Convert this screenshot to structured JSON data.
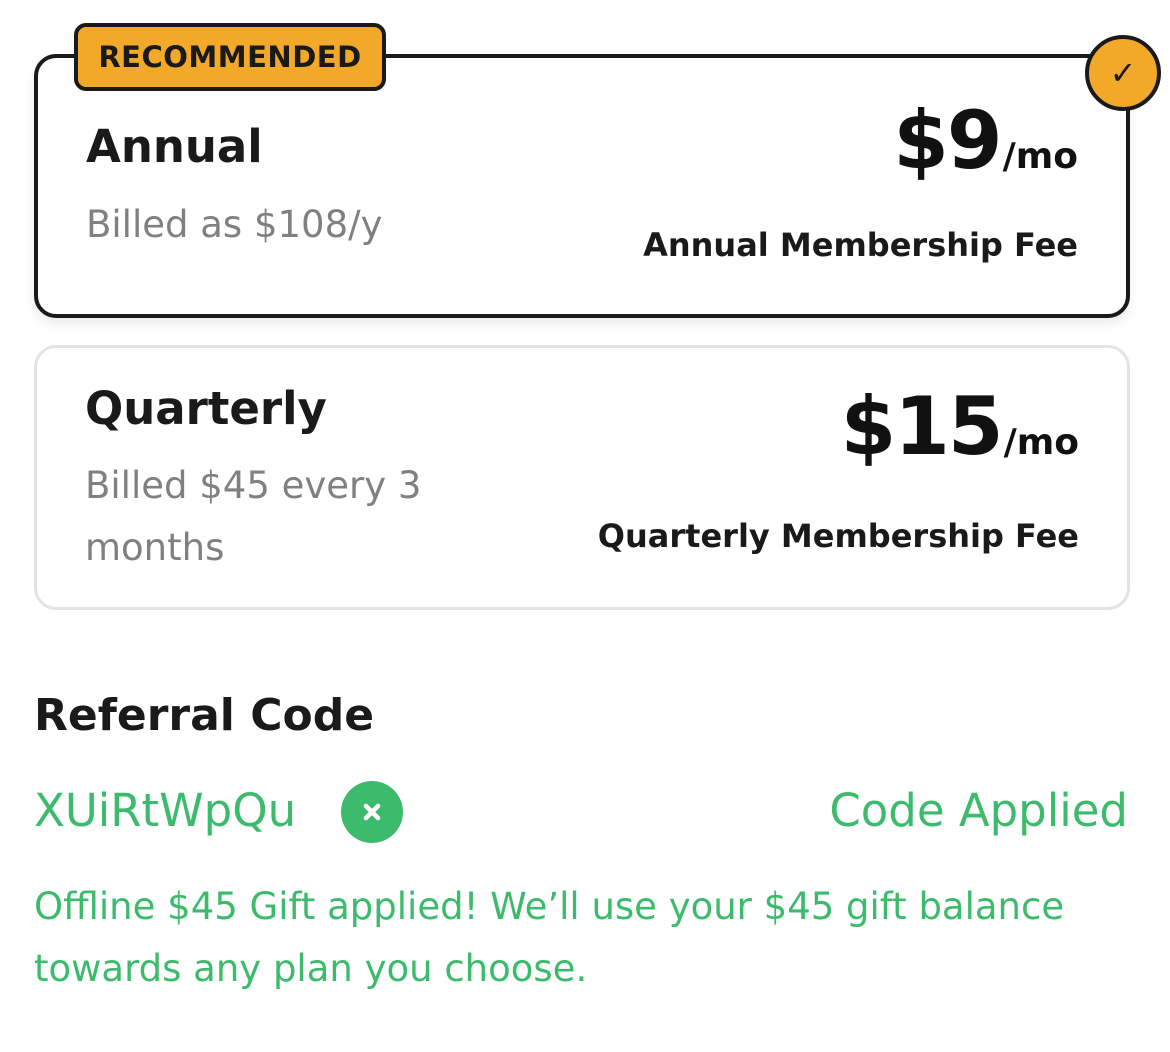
{
  "plans": {
    "annual": {
      "badge": "RECOMMENDED",
      "name": "Annual",
      "billing": "Billed as $108/y",
      "price": "$9",
      "unit": "/mo",
      "fee_label": "Annual Membership Fee",
      "selected": true,
      "check_icon": "✓"
    },
    "quarterly": {
      "name": "Quarterly",
      "billing": "Billed $45 every 3 months",
      "price": "$15",
      "unit": "/mo",
      "fee_label": "Quarterly Membership Fee",
      "selected": false
    }
  },
  "referral": {
    "title": "Referral Code",
    "code": "XUiRtWpQu",
    "status": "Code Applied",
    "message": "Offline $45 Gift applied! We’ll use your $45 gift balance towards any plan you choose.",
    "remove_icon": "close-icon"
  },
  "colors": {
    "accent_orange": "#f2a829",
    "success_green": "#3dbb6d",
    "text_dark": "#1a1a1a",
    "text_muted": "#808080",
    "border_light": "#e3e3e3"
  }
}
